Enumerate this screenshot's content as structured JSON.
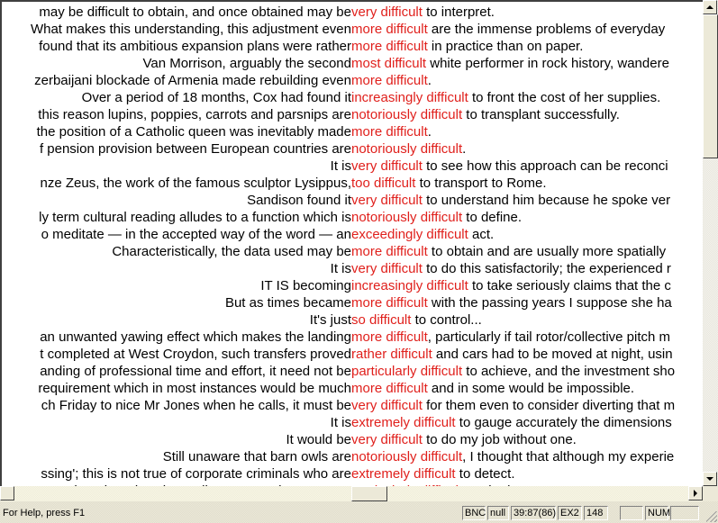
{
  "concordance": {
    "lines": [
      {
        "left": "may be difficult to obtain, and once obtained may be",
        "hit": "very difficult",
        "right": " to interpret."
      },
      {
        "left": "What makes this understanding, this adjustment even",
        "hit": "more difficult",
        "right": " are the immense problems of everyday"
      },
      {
        "left": "found that its ambitious expansion plans were rather",
        "hit": "more difficult",
        "right": " in practice than on paper."
      },
      {
        "left": "Van Morrison, arguably the second",
        "hit": "most difficult",
        "right": " white performer in rock history, wandere"
      },
      {
        "left": "zerbaijani blockade of Armenia made rebuilding even",
        "hit": "more difficult",
        "right": "."
      },
      {
        "left": "Over a period of 18 months, Cox had found it",
        "hit": "increasingly difficult",
        "right": " to front the cost of her supplies."
      },
      {
        "left": "this reason lupins, poppies, carrots and parsnips are",
        "hit": "notoriously difficult",
        "right": " to transplant successfully."
      },
      {
        "left": "the position of a Catholic queen was inevitably made",
        "hit": "more difficult",
        "right": "."
      },
      {
        "left": "f pension provision between European countries are",
        "hit": "notoriously difficult",
        "right": "."
      },
      {
        "left": "It is",
        "hit": "very difficult",
        "right": " to see how this approach can be reconci"
      },
      {
        "left": "nze Zeus, the work of the famous sculptor Lysippus,",
        "hit": " too difficult",
        "right": " to transport to Rome."
      },
      {
        "left": "Sandison found it",
        "hit": "very difficult",
        "right": " to understand him because he spoke ver"
      },
      {
        "left": "ly term cultural reading alludes to a function which is",
        "hit": "notoriously difficult",
        "right": " to define."
      },
      {
        "left": "o meditate — in the accepted way of the word — an",
        "hit": "exceedingly difficult",
        "right": " act."
      },
      {
        "left": "Characteristically, the data used may be",
        "hit": "more difficult",
        "right": " to obtain and are usually more spatially"
      },
      {
        "left": "It is",
        "hit": "very difficult",
        "right": " to do this satisfactorily; the experienced r"
      },
      {
        "left": "IT IS becoming",
        "hit": "increasingly difficult",
        "right": " to take seriously claims that the c"
      },
      {
        "left": "But as times became",
        "hit": "more difficult",
        "right": " with the passing years I suppose she ha"
      },
      {
        "left": "It's just",
        "hit": "so difficult",
        "right": " to control..."
      },
      {
        "left": "an unwanted yawing effect which makes the landing",
        "hit": "more difficult",
        "right": ", particularly if tail rotor/collective pitch m"
      },
      {
        "left": "t completed at West Croydon, such transfers proved",
        "hit": "rather difficult",
        "right": " and cars had to be moved at night, usin"
      },
      {
        "left": "anding of professional time and effort, it need not be",
        "hit": "particularly difficult",
        "right": " to achieve, and the investment sho"
      },
      {
        "left": "requirement which in most instances would be much",
        "hit": "more difficult",
        "right": " and in some would be impossible."
      },
      {
        "left": "ch Friday to nice Mr Jones when he calls, it must be",
        "hit": "very difficult",
        "right": " for them even to consider diverting that m"
      },
      {
        "left": "It is",
        "hit": "extremely difficult",
        "right": " to gauge accurately the dimensions"
      },
      {
        "left": "It would be",
        "hit": "very difficult",
        "right": " to do my job without one."
      },
      {
        "left": "Still unaware that barn owls are",
        "hit": "notoriously difficult",
        "right": ", I thought that although my experie"
      },
      {
        "left": "ssing'; this is not true of corporate criminals who are",
        "hit": "extremely difficult",
        "right": " to detect."
      },
      {
        "left": "n the Mirror, by whom Pilger set much store, was",
        "hit": "particularly difficult",
        "right": " to pin down."
      }
    ]
  },
  "status": {
    "help": "For Help, press F1",
    "corpus": "BNC",
    "mode": "null",
    "position": "39:87(86)",
    "query": "EX2",
    "count": "148",
    "empty1": "",
    "num": "NUM",
    "empty2": ""
  },
  "colors": {
    "hit": "#e0201c"
  }
}
